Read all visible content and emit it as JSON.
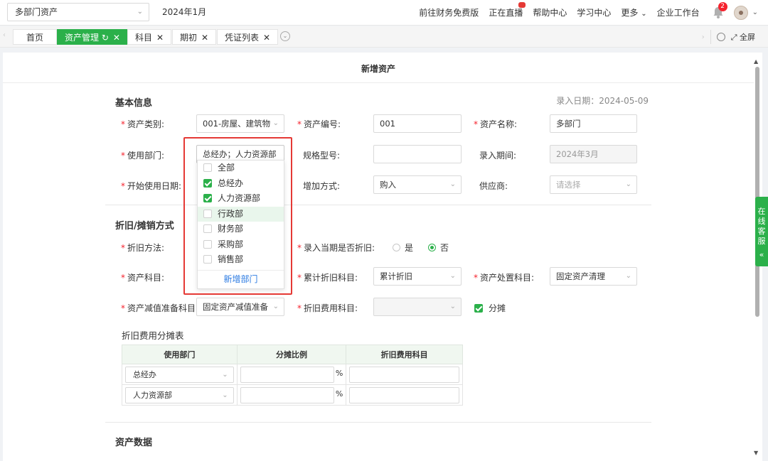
{
  "topbar": {
    "company": "多部门资产",
    "period": "2024年1月",
    "nav": [
      "前往财务免费版",
      "正在直播",
      "帮助中心",
      "学习中心",
      "更多",
      "企业工作台"
    ],
    "notification_count": "2"
  },
  "tabs": [
    {
      "label": "首页"
    },
    {
      "label": "资产管理"
    },
    {
      "label": "科目"
    },
    {
      "label": "期初"
    },
    {
      "label": "凭证列表"
    }
  ],
  "tabbar": {
    "fullscreen": "全屏"
  },
  "page": {
    "title": "新增资产"
  },
  "basic": {
    "title": "基本信息",
    "entry_date": "录入日期：2024-05-09",
    "category_label": "资产类别:",
    "category_value": "001-房屋、建筑物",
    "code_label": "资产编号:",
    "code_value": "001",
    "name_label": "资产名称:",
    "name_value": "多部门",
    "dept_label": "使用部门:",
    "dept_value": "总经办；人力资源部",
    "model_label": "规格型号:",
    "model_value": "",
    "period_label": "录入期间:",
    "period_value": "2024年3月",
    "start_label": "开始使用日期:",
    "add_method_label": "增加方式:",
    "add_method_value": "购入",
    "supplier_label": "供应商:",
    "supplier_placeholder": "请选择"
  },
  "dept_dropdown": {
    "items": [
      {
        "label": "全部",
        "checked": false
      },
      {
        "label": "总经办",
        "checked": true
      },
      {
        "label": "人力资源部",
        "checked": true
      },
      {
        "label": "行政部",
        "checked": false
      },
      {
        "label": "财务部",
        "checked": false
      },
      {
        "label": "采购部",
        "checked": false
      },
      {
        "label": "销售部",
        "checked": false
      }
    ],
    "footer": "新增部门"
  },
  "depreciation": {
    "title": "折旧/摊销方式",
    "method_label": "折旧方法:",
    "current_label": "录入当期是否折旧:",
    "yes": "是",
    "no": "否",
    "asset_subject_label": "资产科目:",
    "accum_label": "累计折旧科目:",
    "accum_value": "累计折旧",
    "disposal_label": "资产处置科目:",
    "disposal_value": "固定资产清理",
    "impairment_label": "资产减值准备科目:",
    "impairment_value": "固定资产减值准备",
    "expense_label": "折旧费用科目:",
    "apportion_label": "分摊"
  },
  "allocation": {
    "title": "折旧费用分摊表",
    "headers": [
      "使用部门",
      "分摊比例",
      "折旧费用科目"
    ],
    "rows": [
      {
        "dept": "总经办",
        "pct": "%"
      },
      {
        "dept": "人力资源部",
        "pct": "%"
      }
    ]
  },
  "asset_data": {
    "title": "资产数据"
  },
  "service": {
    "label": "在线客服"
  },
  "colors": {
    "accent": "#2bb04a",
    "highlight": "#e53935",
    "link": "#2a7ae2"
  }
}
